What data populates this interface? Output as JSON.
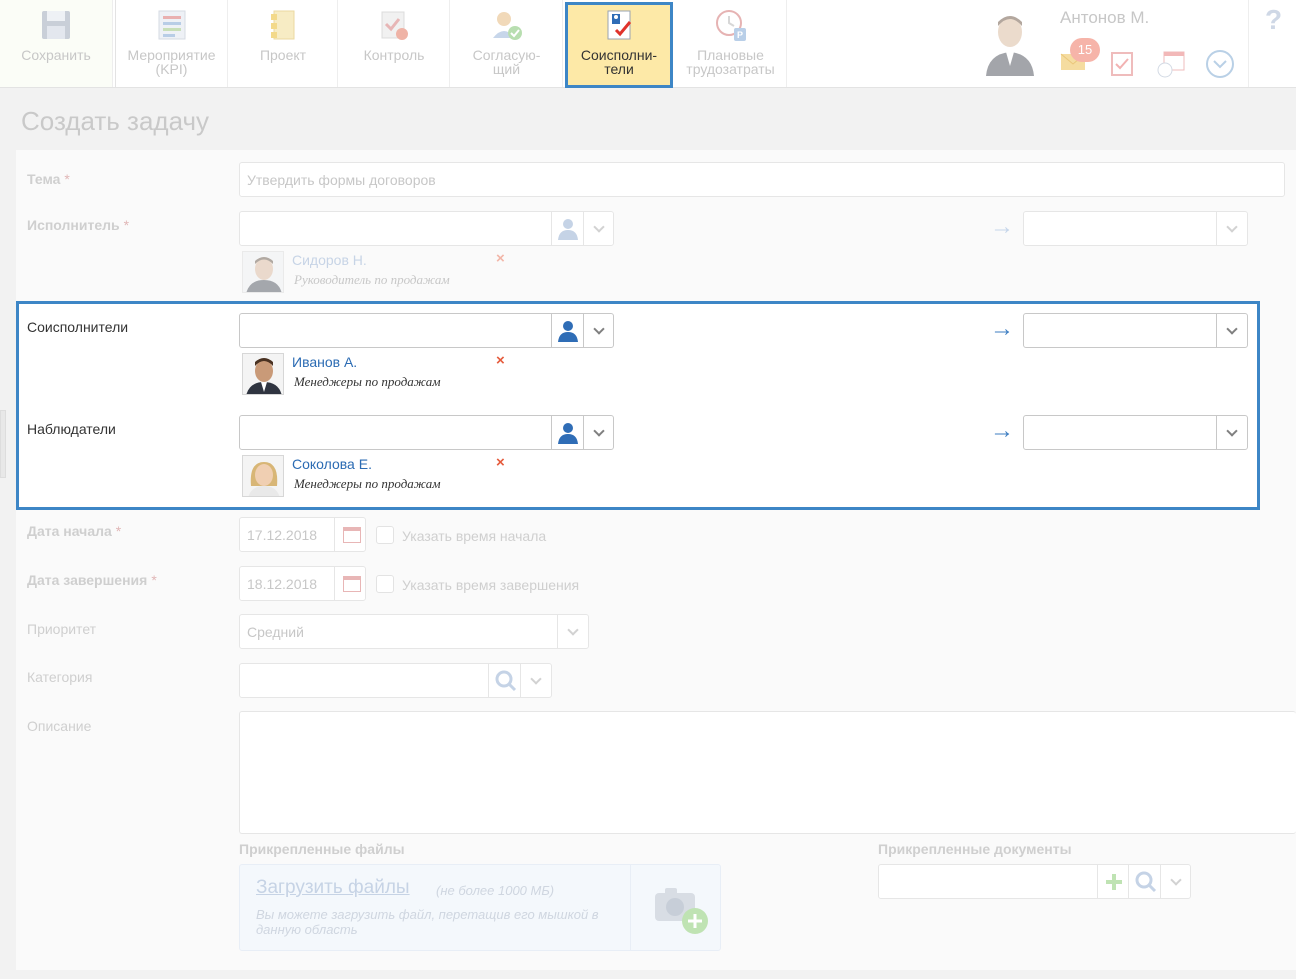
{
  "toolbar": {
    "save": "Сохранить",
    "kpi_line1": "Мероприятие",
    "kpi_line2": "(KPI)",
    "project": "Проект",
    "control": "Контроль",
    "approver_line1": "Согласую-",
    "approver_line2": "щий",
    "coexecutors_line1": "Соисполни-",
    "coexecutors_line2": "тели",
    "planned_line1": "Плановые",
    "planned_line2": "трудозатраты"
  },
  "user": {
    "name": "Антонов М.",
    "notifications_count": "15"
  },
  "help": "?",
  "page_title": "Создать задачу",
  "form": {
    "subject_label": "Тема",
    "subject_value": "Утвердить формы договоров",
    "executor_label": "Исполнитель",
    "executor_person": {
      "name": "Сидоров Н.",
      "role": "Руководитель по продажам"
    },
    "coexecutors_label": "Соисполнители",
    "coexecutors_person": {
      "name": "Иванов А.",
      "role": "Менеджеры по продажам"
    },
    "observers_label": "Наблюдатели",
    "observers_person": {
      "name": "Соколова Е.",
      "role": "Менеджеры по продажам"
    },
    "start_label": "Дата начала",
    "start_value": "17.12.2018",
    "start_time_label": "Указать время начала",
    "end_label": "Дата завершения",
    "end_value": "18.12.2018",
    "end_time_label": "Указать время завершения",
    "priority_label": "Приоритет",
    "priority_value": "Средний",
    "category_label": "Категория",
    "description_label": "Описание",
    "required_mark": "*",
    "remove_mark": "×",
    "arrow_mark": "→"
  },
  "attachments": {
    "files_label": "Прикрепленные файлы",
    "upload_link": "Загрузить файлы",
    "upload_limit": "(не более 1000 МБ)",
    "upload_hint": "Вы можете загрузить файл, перетащив его мышкой в данную область",
    "documents_label": "Прикрепленные документы"
  },
  "colors": {
    "accent": "#3d86c6",
    "active_tab": "#fde9a7",
    "link": "#2b6bb3",
    "remove": "#e55b3c"
  }
}
